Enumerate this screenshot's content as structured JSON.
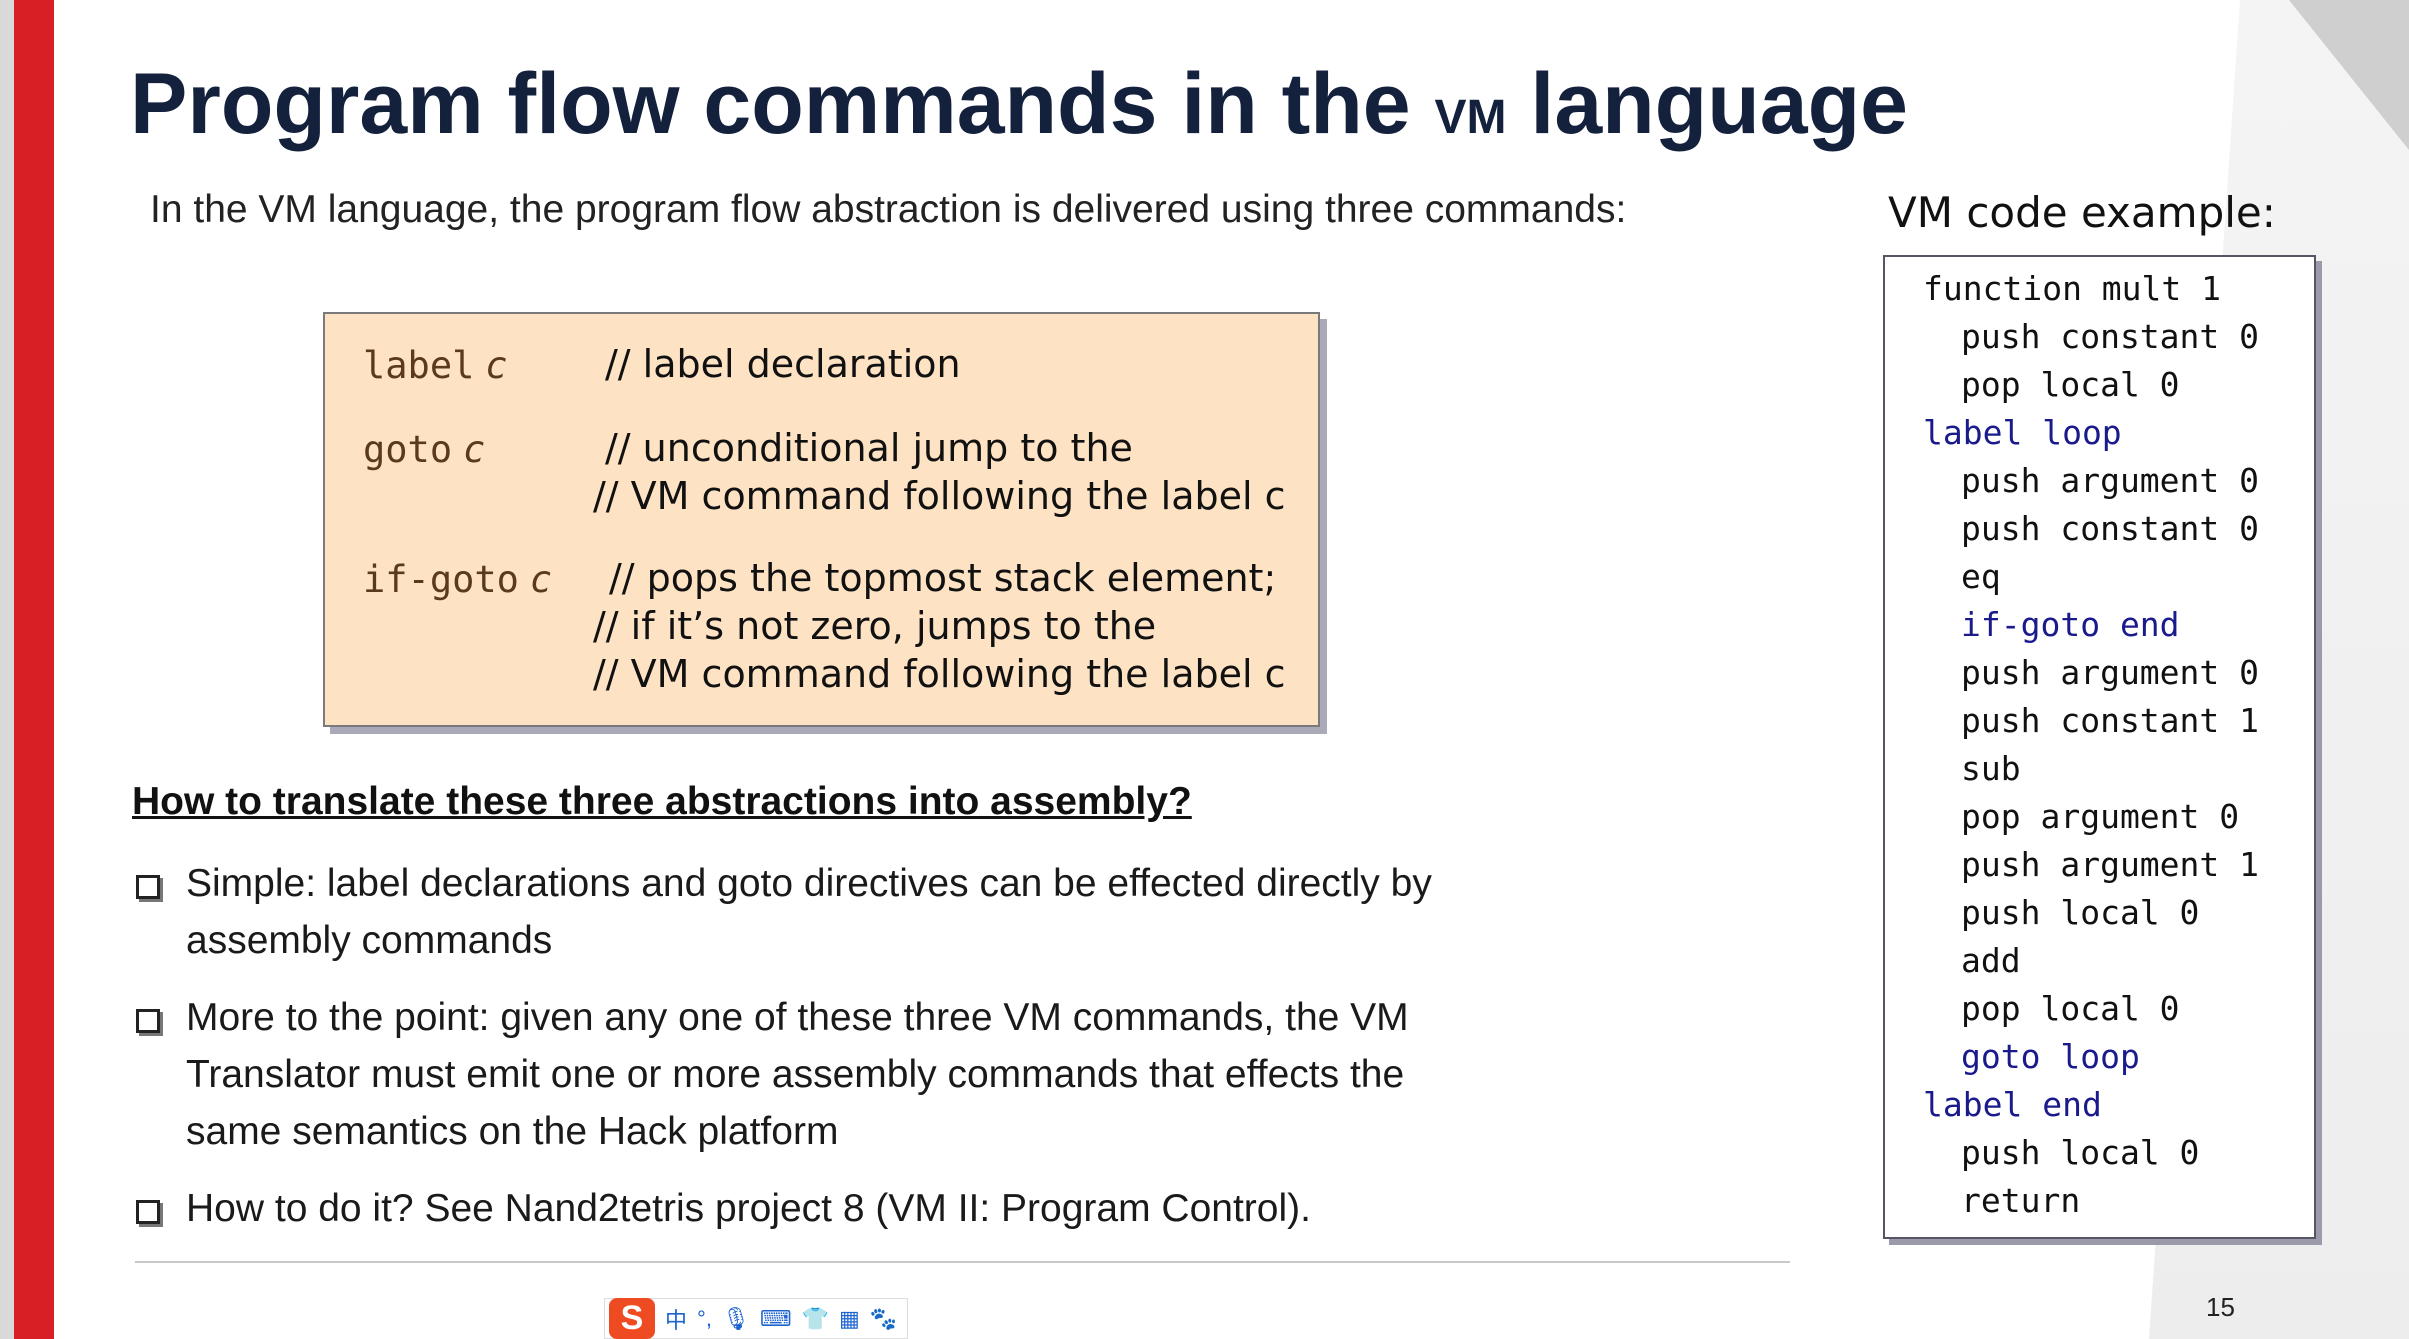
{
  "slide": {
    "title_main": "Program flow commands in the ",
    "title_vm": "VM",
    "title_end": " language",
    "intro": "In the VM language, the program flow abstraction is delivered using three commands:",
    "page_number": "15"
  },
  "commands": [
    {
      "code": "label",
      "arg": "c",
      "comments": [
        "// label declaration"
      ]
    },
    {
      "code": "goto",
      "arg": "c",
      "comments": [
        "// unconditional jump to the",
        "// VM command following the label c"
      ]
    },
    {
      "code": "if-goto",
      "arg": "c",
      "comments": [
        "// pops the topmost stack element;",
        "// if it’s not zero, jumps to the",
        "// VM command following the label c"
      ]
    }
  ],
  "translation": {
    "heading": "How to translate these three abstractions into assembly?",
    "bullets": [
      "Simple: label declarations and goto directives can be effected directly by assembly commands",
      "More to the point: given any one of these three VM commands, the VM Translator must emit one or more assembly commands that effects the same semantics on the Hack platform",
      "How to do it? See Nand2tetris project 8 (VM II: Program Control)."
    ]
  },
  "vm_example": {
    "label": "VM code example:",
    "lines": [
      "function mult 1",
      "push constant 0",
      "pop local 0",
      "label loop",
      "push argument 0",
      "push constant 0",
      "eq",
      "if-goto end",
      "push argument 0",
      "push constant 1",
      "sub",
      "pop argument 0",
      "push argument 1",
      "push local 0",
      "add",
      "pop local 0",
      "goto loop",
      "label end",
      "push local 0",
      "return"
    ]
  },
  "taskbar": {
    "logo": "S",
    "lang": "中",
    "icons": [
      "punctuation-icon",
      "microphone-icon",
      "keyboard-icon",
      "skin-icon",
      "apps-icon",
      "mascot-icon"
    ]
  },
  "colors": {
    "accent_red": "#d81f26",
    "box_fill": "#fde2c4",
    "title": "#14213d",
    "keyword": "#1a1a8c"
  }
}
